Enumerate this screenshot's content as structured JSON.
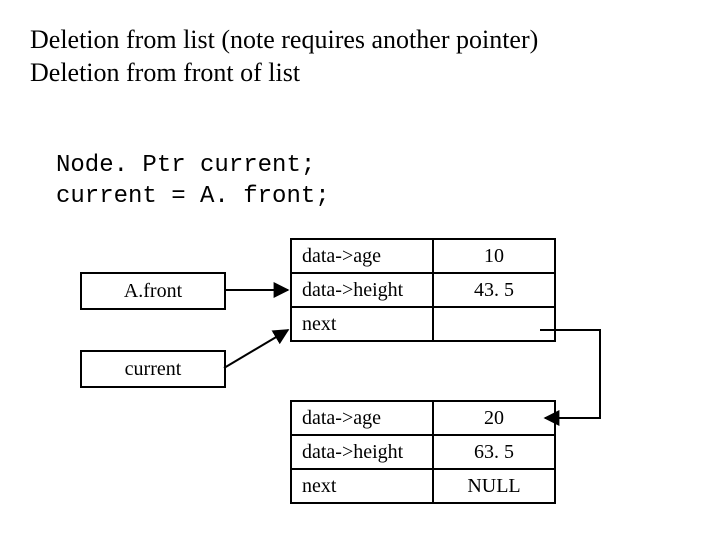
{
  "title_line1": "Deletion from list (note requires another pointer)",
  "title_line2": "Deletion from front of list",
  "code_line1": "Node. Ptr current;",
  "code_line2": "current = A. front;",
  "pointers": {
    "afront": "A.front",
    "current": "current"
  },
  "node1": {
    "row1_label": "data->age",
    "row1_value": "10",
    "row2_label": "data->height",
    "row2_value": "43. 5",
    "row3_label": "next",
    "row3_value": ""
  },
  "node2": {
    "row1_label": "data->age",
    "row1_value": "20",
    "row2_label": "data->height",
    "row2_value": "63. 5",
    "row3_label": "next",
    "row3_value": "NULL"
  },
  "chart_data": {
    "type": "table",
    "title": "Linked-list deletion from front",
    "pointers": [
      {
        "name": "A.front",
        "points_to": "node1"
      },
      {
        "name": "current",
        "points_to": "node1"
      }
    ],
    "nodes": [
      {
        "id": "node1",
        "data->age": 10,
        "data->height": 43.5,
        "next": "node2"
      },
      {
        "id": "node2",
        "data->age": 20,
        "data->height": 63.5,
        "next": null
      }
    ]
  }
}
